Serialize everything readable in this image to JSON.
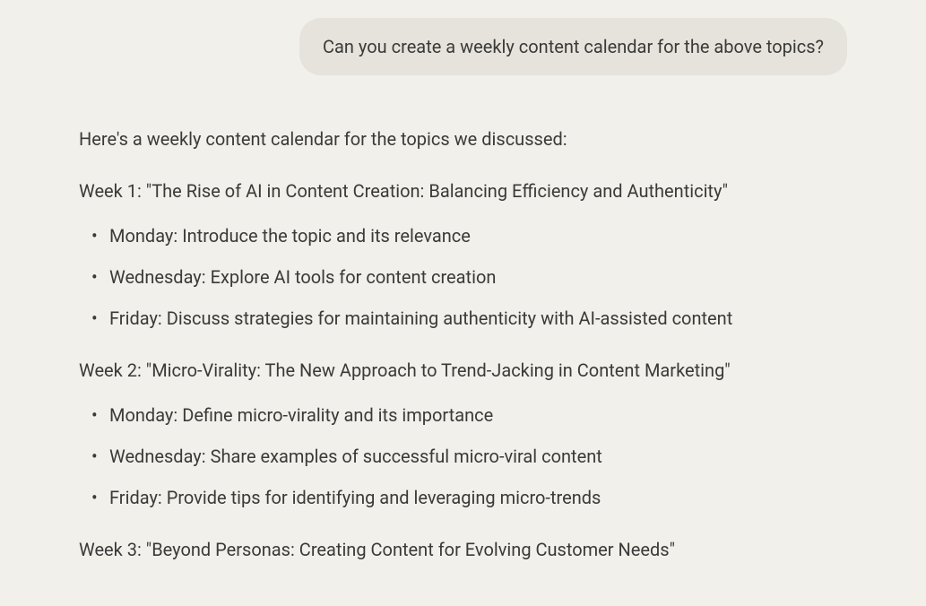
{
  "user_message": "Can you create a weekly content calendar for the above topics?",
  "assistant": {
    "intro": "Here's a weekly content calendar for the topics we discussed:",
    "weeks": [
      {
        "heading": "Week 1: \"The Rise of AI in Content Creation: Balancing Efficiency and Authenticity\"",
        "items": [
          "Monday: Introduce the topic and its relevance",
          "Wednesday: Explore AI tools for content creation",
          "Friday: Discuss strategies for maintaining authenticity with AI-assisted content"
        ]
      },
      {
        "heading": "Week 2: \"Micro-Virality: The New Approach to Trend-Jacking in Content Marketing\"",
        "items": [
          "Monday: Define micro-virality and its importance",
          "Wednesday: Share examples of successful micro-viral content",
          "Friday: Provide tips for identifying and leveraging micro-trends"
        ]
      },
      {
        "heading": "Week 3: \"Beyond Personas: Creating Content for Evolving Customer Needs\"",
        "items": []
      }
    ]
  }
}
